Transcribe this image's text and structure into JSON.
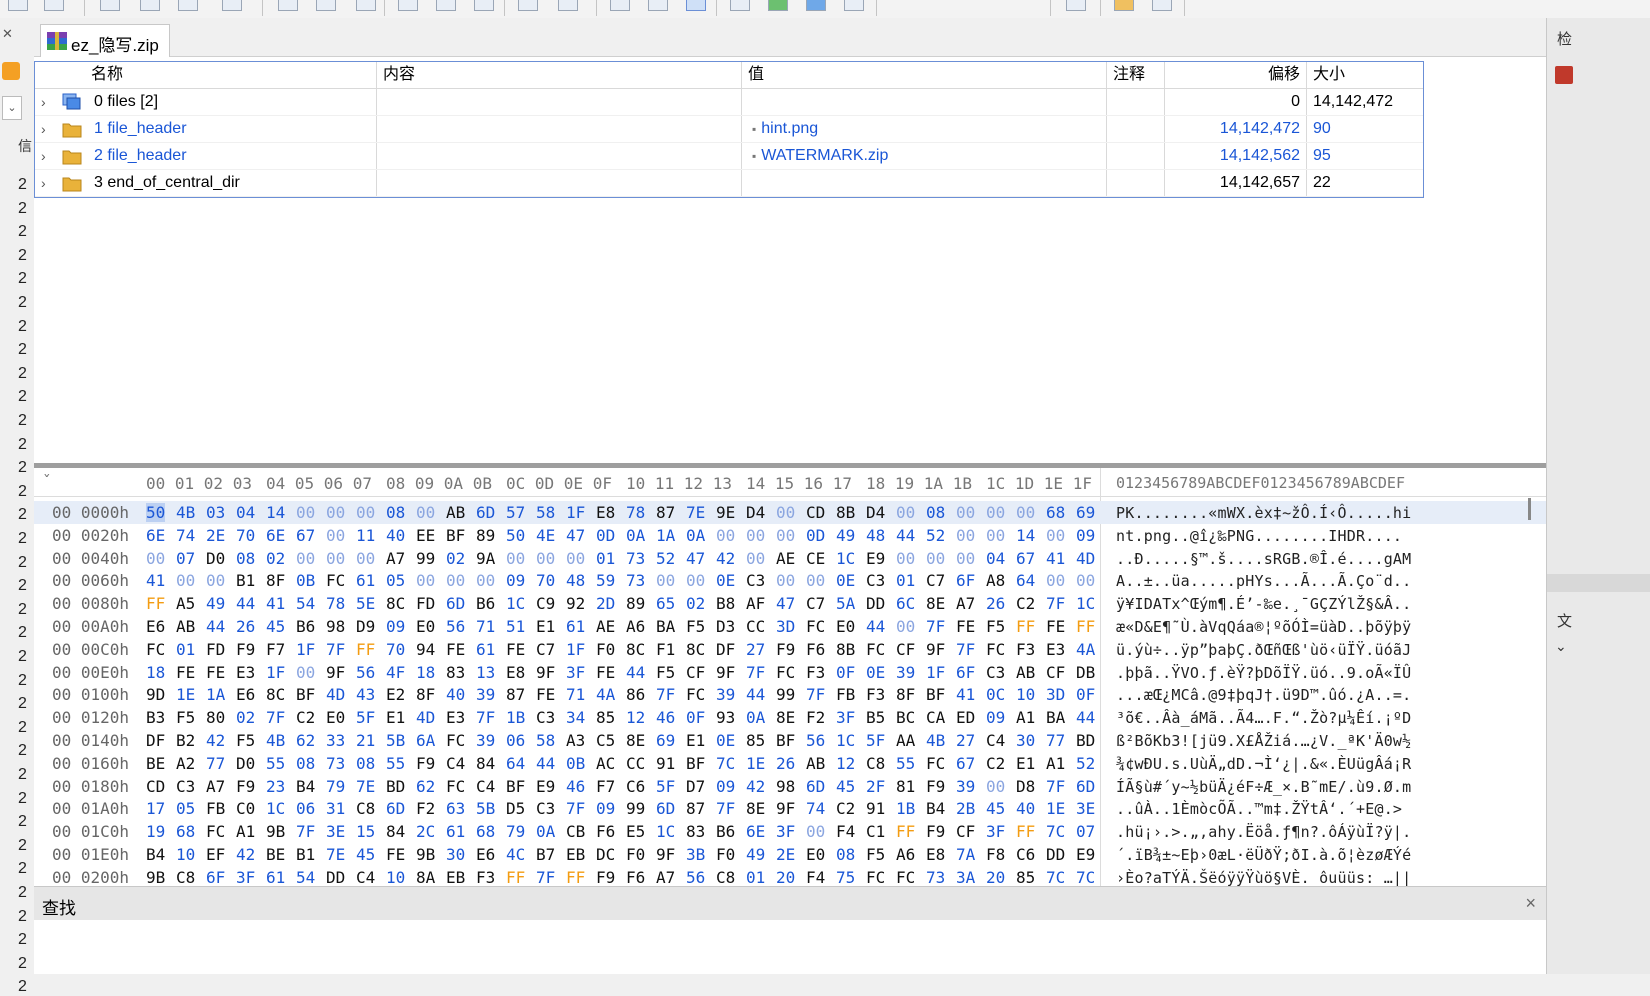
{
  "tab": {
    "filename": "ez_隐写.zip"
  },
  "results": {
    "headers": {
      "name": "名称",
      "content": "内容",
      "value": "值",
      "comment": "注释",
      "offset": "偏移",
      "size": "大小"
    },
    "rows": [
      {
        "name": "0 files [2]",
        "value": "",
        "offset": "0",
        "size": "14,142,472",
        "icon": "files-stack-icon",
        "highlight": false
      },
      {
        "name": "1 file_header",
        "value": "hint.png",
        "offset": "14,142,472",
        "size": "90",
        "icon": "folder-icon",
        "highlight": true
      },
      {
        "name": "2 file_header",
        "value": "WATERMARK.zip",
        "offset": "14,142,562",
        "size": "95",
        "icon": "folder-icon",
        "highlight": true
      },
      {
        "name": "3 end_of_central_dir",
        "value": "",
        "offset": "14,142,657",
        "size": "22",
        "icon": "folder-icon",
        "highlight": false
      }
    ]
  },
  "left_strip": {
    "top_label": "信",
    "digits": [
      "2",
      "2",
      "2",
      "2",
      "2",
      "2",
      "2",
      "2",
      "2",
      "2",
      "2",
      "2",
      "2",
      "2",
      "2",
      "2",
      "2",
      "2",
      "2",
      "2",
      "2",
      "2",
      "2",
      "2",
      "2",
      "2",
      "2",
      "2",
      "2",
      "2",
      "2",
      "2",
      "2",
      "2",
      "2"
    ]
  },
  "right_strip": {
    "top_label": "检",
    "side_label": "文"
  },
  "hex": {
    "corner": "ˇ",
    "header_groups": [
      "00 01 02 03",
      "04 05 06 07",
      "08 09 0A 0B",
      "0C 0D 0E 0F",
      "10 11 12 13",
      "14 15 16 17",
      "18 19 1A 1B",
      "1C 1D 1E 1F"
    ],
    "ascii_header": "0123456789ABCDEF0123456789ABCDEF",
    "rows": [
      {
        "offset": "00 0000h",
        "bytes": [
          "50",
          "4B",
          "03",
          "04",
          "14",
          "00",
          "00",
          "00",
          "08",
          "00",
          "AB",
          "6D",
          "57",
          "58",
          "1F",
          "E8",
          "78",
          "87",
          "7E",
          "9E",
          "D4",
          "00",
          "CD",
          "8B",
          "D4",
          "00",
          "08",
          "00",
          "00",
          "00",
          "68",
          "69"
        ],
        "ascii": "PK........«mWX.èx‡~žÔ.Í‹Ô.....hi"
      },
      {
        "offset": "00 0020h",
        "bytes": [
          "6E",
          "74",
          "2E",
          "70",
          "6E",
          "67",
          "00",
          "11",
          "40",
          "EE",
          "BF",
          "89",
          "50",
          "4E",
          "47",
          "0D",
          "0A",
          "1A",
          "0A",
          "00",
          "00",
          "00",
          "0D",
          "49",
          "48",
          "44",
          "52",
          "00",
          "00",
          "14",
          "00",
          "09"
        ],
        "ascii": "nt.png..@î¿‰PNG........IHDR...."
      },
      {
        "offset": "00 0040h",
        "bytes": [
          "00",
          "07",
          "D0",
          "08",
          "02",
          "00",
          "00",
          "00",
          "A7",
          "99",
          "02",
          "9A",
          "00",
          "00",
          "00",
          "01",
          "73",
          "52",
          "47",
          "42",
          "00",
          "AE",
          "CE",
          "1C",
          "E9",
          "00",
          "00",
          "00",
          "04",
          "67",
          "41",
          "4D"
        ],
        "ascii": "..Ð.....§™.š....sRGB.®Î.é....gAM"
      },
      {
        "offset": "00 0060h",
        "bytes": [
          "41",
          "00",
          "00",
          "B1",
          "8F",
          "0B",
          "FC",
          "61",
          "05",
          "00",
          "00",
          "00",
          "09",
          "70",
          "48",
          "59",
          "73",
          "00",
          "00",
          "0E",
          "C3",
          "00",
          "00",
          "0E",
          "C3",
          "01",
          "C7",
          "6F",
          "A8",
          "64",
          "00",
          "00"
        ],
        "ascii": "A..±..üa.....pHYs...Ã...Ã.Ço¨d.."
      },
      {
        "offset": "00 0080h",
        "bytes": [
          "FF",
          "A5",
          "49",
          "44",
          "41",
          "54",
          "78",
          "5E",
          "8C",
          "FD",
          "6D",
          "B6",
          "1C",
          "C9",
          "92",
          "2D",
          "89",
          "65",
          "02",
          "B8",
          "AF",
          "47",
          "C7",
          "5A",
          "DD",
          "6C",
          "8E",
          "A7",
          "26",
          "C2",
          "7F",
          "1C"
        ],
        "ascii": "ÿ¥IDATx^Œým¶.É’-‰e.¸¯GÇZÝlŽ§&Â.."
      },
      {
        "offset": "00 00A0h",
        "bytes": [
          "E6",
          "AB",
          "44",
          "26",
          "45",
          "B6",
          "98",
          "D9",
          "09",
          "E0",
          "56",
          "71",
          "51",
          "E1",
          "61",
          "AE",
          "A6",
          "BA",
          "F5",
          "D3",
          "CC",
          "3D",
          "FC",
          "E0",
          "44",
          "00",
          "7F",
          "FE",
          "F5",
          "FF",
          "FE",
          "FF"
        ],
        "ascii": "æ«D&E¶˜Ù.àVqQáa®¦ºõÓÌ=üàD..þõÿþÿ"
      },
      {
        "offset": "00 00C0h",
        "bytes": [
          "FC",
          "01",
          "FD",
          "F9",
          "F7",
          "1F",
          "7F",
          "FF",
          "70",
          "94",
          "FE",
          "61",
          "FE",
          "C7",
          "1F",
          "F0",
          "8C",
          "F1",
          "8C",
          "DF",
          "27",
          "F9",
          "F6",
          "8B",
          "FC",
          "CF",
          "9F",
          "7F",
          "FC",
          "F3",
          "E3",
          "4A"
        ],
        "ascii": "ü.ýù÷..ÿp”þaþÇ.ðŒñŒß'ùö‹üÏŸ.üóãJ"
      },
      {
        "offset": "00 00E0h",
        "bytes": [
          "18",
          "FE",
          "FE",
          "E3",
          "1F",
          "00",
          "9F",
          "56",
          "4F",
          "18",
          "83",
          "13",
          "E8",
          "9F",
          "3F",
          "FE",
          "44",
          "F5",
          "CF",
          "9F",
          "7F",
          "FC",
          "F3",
          "0F",
          "0E",
          "39",
          "1F",
          "6F",
          "C3",
          "AB",
          "CF",
          "DB"
        ],
        "ascii": ".þþã..ŸVO.ƒ.èŸ?þDõÏŸ.üó..9.oÃ«ÏÛ"
      },
      {
        "offset": "00 0100h",
        "bytes": [
          "9D",
          "1E",
          "1A",
          "E6",
          "8C",
          "BF",
          "4D",
          "43",
          "E2",
          "8F",
          "40",
          "39",
          "87",
          "FE",
          "71",
          "4A",
          "86",
          "7F",
          "FC",
          "39",
          "44",
          "99",
          "7F",
          "FB",
          "F3",
          "8F",
          "BF",
          "41",
          "0C",
          "10",
          "3D",
          "0F"
        ],
        "ascii": "...æŒ¿MCâ.@9‡þqJ†.ü9D™.ûó.¿A..=."
      },
      {
        "offset": "00 0120h",
        "bytes": [
          "B3",
          "F5",
          "80",
          "02",
          "7F",
          "C2",
          "E0",
          "5F",
          "E1",
          "4D",
          "E3",
          "7F",
          "1B",
          "C3",
          "34",
          "85",
          "12",
          "46",
          "0F",
          "93",
          "0A",
          "8E",
          "F2",
          "3F",
          "B5",
          "BC",
          "CA",
          "ED",
          "09",
          "A1",
          "BA",
          "44"
        ],
        "ascii": "³õ€..Âà_áMã..Ã4….F.“.Žò?µ¼Êí.¡ºD"
      },
      {
        "offset": "00 0140h",
        "bytes": [
          "DF",
          "B2",
          "42",
          "F5",
          "4B",
          "62",
          "33",
          "21",
          "5B",
          "6A",
          "FC",
          "39",
          "06",
          "58",
          "A3",
          "C5",
          "8E",
          "69",
          "E1",
          "0E",
          "85",
          "BF",
          "56",
          "1C",
          "5F",
          "AA",
          "4B",
          "27",
          "C4",
          "30",
          "77",
          "BD"
        ],
        "ascii": "ß²BõKb3![jü9.X£ÅŽiá.…¿V._ªK'Ä0w½"
      },
      {
        "offset": "00 0160h",
        "bytes": [
          "BE",
          "A2",
          "77",
          "D0",
          "55",
          "08",
          "73",
          "08",
          "55",
          "F9",
          "C4",
          "84",
          "64",
          "44",
          "0B",
          "AC",
          "CC",
          "91",
          "BF",
          "7C",
          "1E",
          "26",
          "AB",
          "12",
          "C8",
          "55",
          "FC",
          "67",
          "C2",
          "E1",
          "A1",
          "52"
        ],
        "ascii": "¾¢wÐU.s.UùÄ„dD.¬Ì‘¿|.&«.ÈUügÂá¡R"
      },
      {
        "offset": "00 0180h",
        "bytes": [
          "CD",
          "C3",
          "A7",
          "F9",
          "23",
          "B4",
          "79",
          "7E",
          "BD",
          "62",
          "FC",
          "C4",
          "BF",
          "E9",
          "46",
          "F7",
          "C6",
          "5F",
          "D7",
          "09",
          "42",
          "98",
          "6D",
          "45",
          "2F",
          "81",
          "F9",
          "39",
          "00",
          "D8",
          "7F",
          "6D"
        ],
        "ascii": "ÍÃ§ù#´y~½büÄ¿éF÷Æ_×.B˜mE/.ù9.Ø.m"
      },
      {
        "offset": "00 01A0h",
        "bytes": [
          "17",
          "05",
          "FB",
          "C0",
          "1C",
          "06",
          "31",
          "C8",
          "6D",
          "F2",
          "63",
          "5B",
          "D5",
          "C3",
          "7F",
          "09",
          "99",
          "6D",
          "87",
          "7F",
          "8E",
          "9F",
          "74",
          "C2",
          "91",
          "1B",
          "B4",
          "2B",
          "45",
          "40",
          "1E",
          "3E"
        ],
        "ascii": "..ûÀ..1ÈmòcÕÃ..™m‡.ŽŸtÂ‘.´+E@.>"
      },
      {
        "offset": "00 01C0h",
        "bytes": [
          "19",
          "68",
          "FC",
          "A1",
          "9B",
          "7F",
          "3E",
          "15",
          "84",
          "2C",
          "61",
          "68",
          "79",
          "0A",
          "CB",
          "F6",
          "E5",
          "1C",
          "83",
          "B6",
          "6E",
          "3F",
          "00",
          "F4",
          "C1",
          "FF",
          "F9",
          "CF",
          "3F",
          "FF",
          "7C",
          "07"
        ],
        "ascii": ".hü¡›.>.„,ahy.Ëöå.ƒ¶n?.ôÁÿùÏ?ÿ|."
      },
      {
        "offset": "00 01E0h",
        "bytes": [
          "B4",
          "10",
          "EF",
          "42",
          "BE",
          "B1",
          "7E",
          "45",
          "FE",
          "9B",
          "30",
          "E6",
          "4C",
          "B7",
          "EB",
          "DC",
          "F0",
          "9F",
          "3B",
          "F0",
          "49",
          "2E",
          "E0",
          "08",
          "F5",
          "A6",
          "E8",
          "7A",
          "F8",
          "C6",
          "DD",
          "E9"
        ],
        "ascii": "´.ïB¾±~Eþ›0æL·ëÜðŸ;ðI.à.õ¦èzøÆÝé"
      },
      {
        "offset": "00 0200h",
        "bytes": [
          "9B",
          "C8",
          "6F",
          "3F",
          "61",
          "54",
          "DD",
          "C4",
          "10",
          "8A",
          "EB",
          "F3",
          "FF",
          "7F",
          "FF",
          "F9",
          "F6",
          "A7",
          "56",
          "C8",
          "01",
          "20",
          "F4",
          "75",
          "FC",
          "FC",
          "73",
          "3A",
          "20",
          "85",
          "7C",
          "7C"
        ],
        "ascii": "›Èo?aTÝÄ.ŠëóÿÿŸùö§VÈ. ôuüüs: …||"
      }
    ]
  },
  "find": {
    "title": "查找",
    "close": "×"
  }
}
